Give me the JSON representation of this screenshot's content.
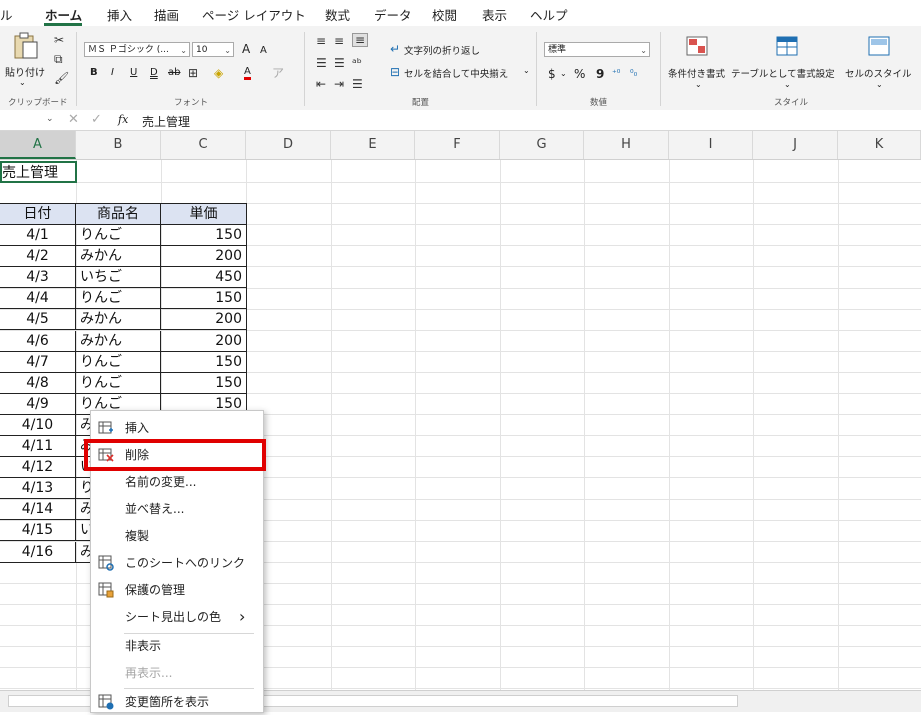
{
  "tabs": [
    "ル",
    "ホーム",
    "挿入",
    "描画",
    "ページ レイアウト",
    "数式",
    "データ",
    "校閲",
    "表示",
    "ヘルプ"
  ],
  "ribbon": {
    "clipboard": {
      "paste_label": "貼り付け",
      "group_label": "クリップボード"
    },
    "font": {
      "font_name": "ＭＳ Ｐゴシック (...",
      "font_size": "10",
      "grow": "A",
      "shrink": "A",
      "bold": "B",
      "italic": "I",
      "underline": "U",
      "double_underline": "D",
      "strike": "ab",
      "font_color": "A",
      "group_label": "フォント"
    },
    "alignment": {
      "wrap_text": "文字列の折り返し",
      "merge_center": "セルを結合して中央揃え",
      "group_label": "配置"
    },
    "number": {
      "format": "標準",
      "currency": "$",
      "percent": "%",
      "comma": "9",
      "group_label": "数値"
    },
    "styles": {
      "conditional": "条件付き書式",
      "table": "テーブルとして書式設定",
      "cell_styles": "セルのスタイル",
      "group_label": "スタイル"
    }
  },
  "formula_bar": {
    "fx": "fx",
    "content": "売上管理"
  },
  "columns": [
    "A",
    "B",
    "C",
    "D",
    "E",
    "F",
    "G",
    "H",
    "I",
    "J",
    "K"
  ],
  "sheet": {
    "title": "売上管理",
    "headers": [
      "日付",
      "商品名",
      "単価"
    ],
    "rows": [
      [
        "4/1",
        "りんご",
        "150"
      ],
      [
        "4/2",
        "みかん",
        "200"
      ],
      [
        "4/3",
        "いちご",
        "450"
      ],
      [
        "4/4",
        "りんご",
        "150"
      ],
      [
        "4/5",
        "みかん",
        "200"
      ],
      [
        "4/6",
        "みかん",
        "200"
      ],
      [
        "4/7",
        "りんご",
        "150"
      ],
      [
        "4/8",
        "りんご",
        "150"
      ],
      [
        "4/9",
        "りんご",
        "150"
      ],
      [
        "4/10",
        "み",
        ""
      ],
      [
        "4/11",
        "み",
        ""
      ],
      [
        "4/12",
        "い",
        ""
      ],
      [
        "4/13",
        "り",
        ""
      ],
      [
        "4/14",
        "み",
        ""
      ],
      [
        "4/15",
        "い",
        ""
      ],
      [
        "4/16",
        "み",
        ""
      ]
    ]
  },
  "context_menu": {
    "items": [
      {
        "label": "挿入",
        "icon": "insert-sheet-icon"
      },
      {
        "label": "削除",
        "icon": "delete-sheet-icon"
      },
      {
        "label": "名前の変更..."
      },
      {
        "label": "並べ替え..."
      },
      {
        "label": "複製"
      },
      {
        "label": "このシートへのリンク",
        "icon": "link-sheet-icon"
      },
      {
        "label": "保護の管理",
        "icon": "protect-sheet-icon"
      },
      {
        "label": "シート見出しの色",
        "submenu": "›"
      },
      {
        "label": "非表示"
      },
      {
        "label": "再表示...",
        "disabled": true
      },
      {
        "label": "変更箇所を表示",
        "icon": "show-changes-icon"
      }
    ]
  },
  "colors": {
    "accent": "#217346",
    "highlight": "#e00000",
    "header_fill": "#dce3f2"
  }
}
